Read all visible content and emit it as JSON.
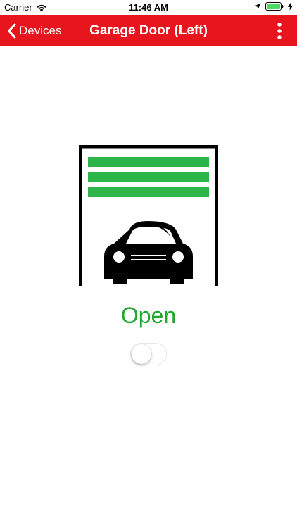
{
  "status_bar": {
    "carrier": "Carrier",
    "time": "11:46 AM"
  },
  "nav": {
    "back_label": "Devices",
    "title": "Garage Door (Left)",
    "background_color": "#e8141e"
  },
  "device": {
    "icon": "garage-open-car-icon",
    "door_slat_color": "#2db54a",
    "state_label": "Open",
    "state_color": "#22a832",
    "toggle_on": false
  }
}
